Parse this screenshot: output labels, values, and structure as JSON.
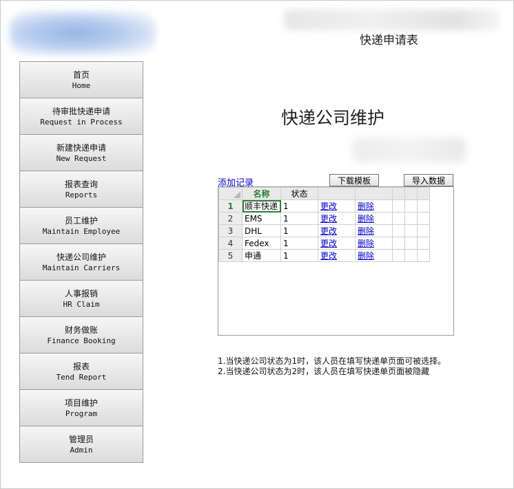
{
  "app": {
    "title": "快递申请表"
  },
  "sidebar": {
    "items": [
      {
        "cn": "首页",
        "en": "Home"
      },
      {
        "cn": "待审批快递申请",
        "en": "Request in Process"
      },
      {
        "cn": "新建快递申请",
        "en": "New Request"
      },
      {
        "cn": "报表查询",
        "en": "Reports"
      },
      {
        "cn": "员工维护",
        "en": "Maintain Employee"
      },
      {
        "cn": "快递公司维护",
        "en": "Maintain Carriers"
      },
      {
        "cn": "人事报销",
        "en": "HR Claim"
      },
      {
        "cn": "财务做账",
        "en": "Finance Booking"
      },
      {
        "cn": "报表",
        "en": "Tend Report"
      },
      {
        "cn": "项目维护",
        "en": "Program"
      },
      {
        "cn": "管理员",
        "en": "Admin"
      }
    ]
  },
  "main": {
    "page_title": "快递公司维护",
    "add_link": "添加记录",
    "download_button": "下载模板",
    "import_button": "导入数据"
  },
  "grid": {
    "headers": {
      "name": "名称",
      "status": "状态"
    },
    "rows": [
      {
        "num": "1",
        "name": "顺丰快递",
        "status": "1",
        "edit": "更改",
        "del": "删除"
      },
      {
        "num": "2",
        "name": "EMS",
        "status": "1",
        "edit": "更改",
        "del": "删除"
      },
      {
        "num": "3",
        "name": "DHL",
        "status": "1",
        "edit": "更改",
        "del": "删除"
      },
      {
        "num": "4",
        "name": "Fedex",
        "status": "1",
        "edit": "更改",
        "del": "删除"
      },
      {
        "num": "5",
        "name": "申通",
        "status": "1",
        "edit": "更改",
        "del": "删除"
      }
    ]
  },
  "notes": {
    "line1": "1.当快递公司状态为1时，该人员在填写快递单页面可被选择。",
    "line2": "2.当快递公司状态为2时，该人员在填写快递单页面被隐藏"
  },
  "colors": {
    "header_name": "#2e7d32",
    "link": "#0000cc",
    "selection": "#2e7d32"
  }
}
